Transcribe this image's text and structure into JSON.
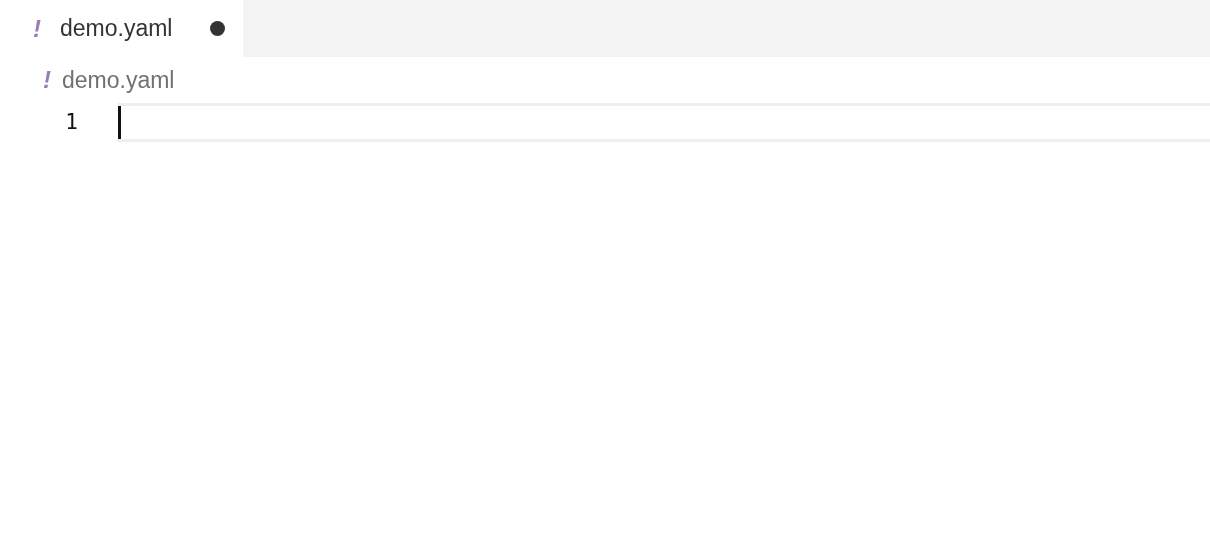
{
  "tabs": [
    {
      "icon": "!",
      "label": "demo.yaml",
      "dirty": true,
      "selected": true
    }
  ],
  "breadcrumb": {
    "icon": "!",
    "label": "demo.yaml"
  },
  "editor": {
    "lines": [
      {
        "number": "1",
        "current": true
      }
    ]
  }
}
